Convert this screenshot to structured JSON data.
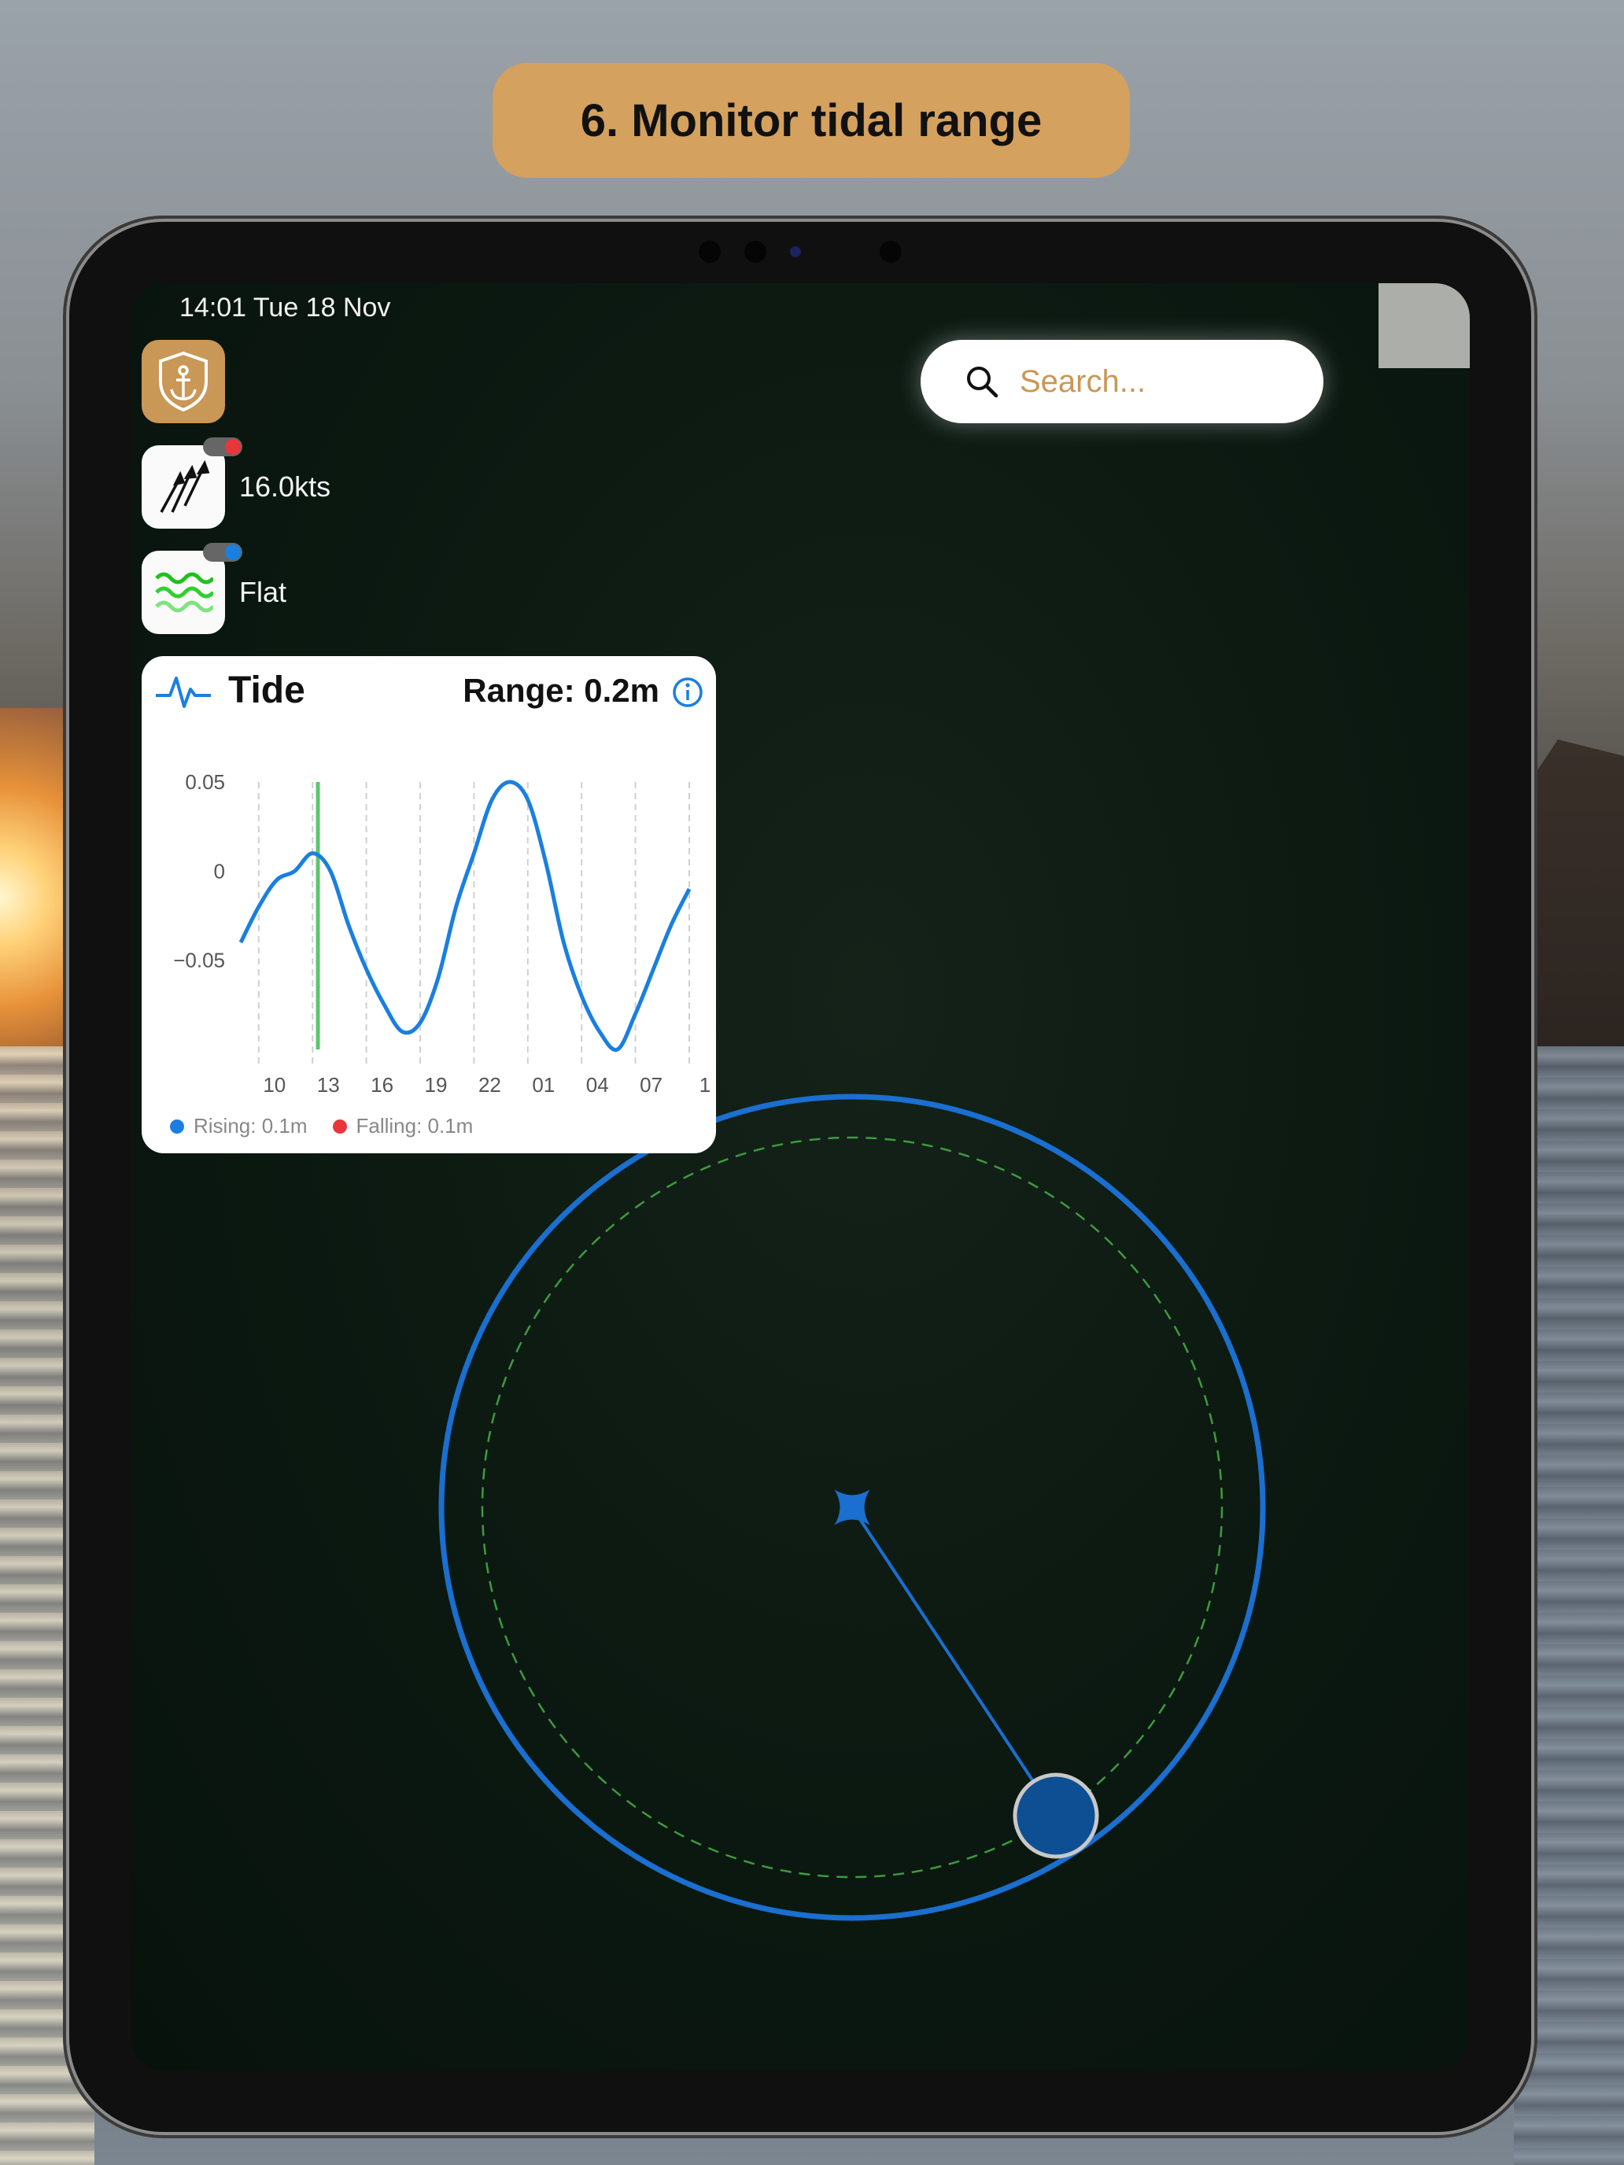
{
  "banner": {
    "title": "6. Monitor tidal range"
  },
  "status_bar": {
    "time_date": "14:01  Tue 18 Nov"
  },
  "controls": {
    "anchor": {
      "icon": "anchor-shield-icon"
    },
    "wind": {
      "icon": "wind-arrows-icon",
      "value": "16.0kts",
      "toggle_color": "#e8363b"
    },
    "waves": {
      "icon": "waves-icon",
      "value": "Flat",
      "toggle_color": "#1a7fe0"
    }
  },
  "search": {
    "placeholder": "Search...",
    "icon": "search-icon"
  },
  "tide": {
    "title": "Tide",
    "range": "Range: 0.2m",
    "info_icon": "info-icon",
    "legend": [
      {
        "label": "Rising: 0.1m",
        "color": "#1a7fe0"
      },
      {
        "label": "Falling: 0.1m",
        "color": "#e8363b"
      }
    ]
  },
  "chart_data": {
    "type": "line",
    "x": [
      9,
      10,
      11,
      12,
      13,
      14,
      15,
      16,
      17,
      18,
      19,
      20,
      21,
      22,
      23,
      24,
      25,
      26,
      27,
      28,
      29,
      30,
      31,
      32,
      33,
      34
    ],
    "values": [
      -0.04,
      -0.02,
      -0.005,
      0.0,
      0.01,
      0.0,
      -0.03,
      -0.055,
      -0.075,
      -0.09,
      -0.085,
      -0.06,
      -0.02,
      0.01,
      0.04,
      0.05,
      0.04,
      0.005,
      -0.04,
      -0.07,
      -0.09,
      -0.1,
      -0.08,
      -0.055,
      -0.03,
      -0.01
    ],
    "x_tick_labels": [
      "10",
      "13",
      "16",
      "19",
      "22",
      "01",
      "04",
      "07",
      "1"
    ],
    "y_tick_labels": [
      "0.05",
      "0",
      "−0.05"
    ],
    "ylim": [
      -0.1,
      0.05
    ],
    "current_time_marker": 13.3,
    "series_color": "#1a7fe0",
    "marker_color": "#5ec46e",
    "grid": true
  },
  "map": {
    "anchor_icon": "anchor-star-icon",
    "boat_icon": "boat-position-icon",
    "outer_circle_color": "#1a6fd0",
    "inner_circle_color": "#3e9a3e"
  }
}
